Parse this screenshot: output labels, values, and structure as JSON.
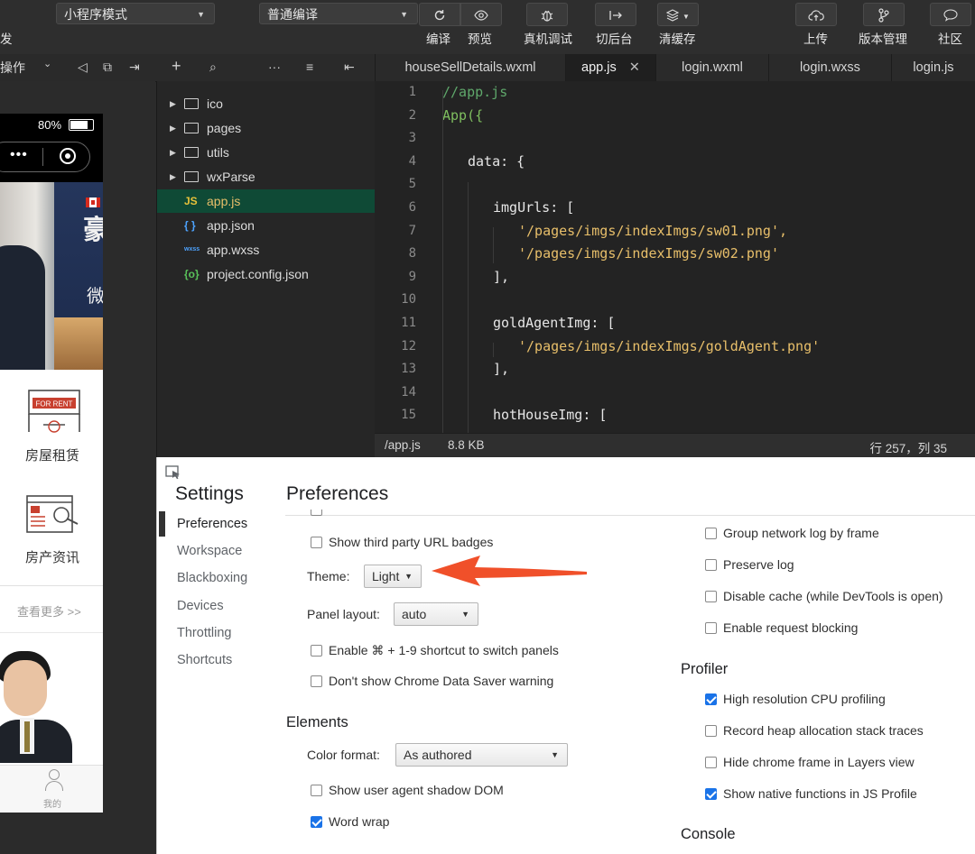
{
  "toolbar": {
    "left_cut_label": "发",
    "mode_select": "小程序模式",
    "compile_select": "普通编译",
    "buttons": [
      "编译",
      "预览",
      "真机调试",
      "切后台",
      "清缓存",
      "上传",
      "版本管理",
      "社区"
    ]
  },
  "subbar": {
    "ops_label": "操作"
  },
  "tabs": [
    "houseSellDetails.wxml",
    "app.js",
    "login.wxml",
    "login.wxss",
    "login.js"
  ],
  "active_tab": "app.js",
  "simulator": {
    "battery": "80%",
    "rent_label": "房屋租赁",
    "news_label": "房产资讯",
    "more_label": "查看更多 >>",
    "mine_label": "我的",
    "sign_text": "FOR RENT",
    "banner_char1": "豪",
    "banner_char2": "微"
  },
  "file_tree": [
    {
      "name": "ico",
      "type": "folder"
    },
    {
      "name": "pages",
      "type": "folder"
    },
    {
      "name": "utils",
      "type": "folder"
    },
    {
      "name": "wxParse",
      "type": "folder"
    },
    {
      "name": "app.js",
      "type": "js",
      "badge": "JS",
      "selected": true
    },
    {
      "name": "app.json",
      "type": "json",
      "badge": "{ }"
    },
    {
      "name": "app.wxss",
      "type": "wxss",
      "badge": "wxss"
    },
    {
      "name": "project.config.json",
      "type": "config",
      "badge": "{o}"
    }
  ],
  "editor": {
    "line_numbers": [
      "1",
      "2",
      "3",
      "4",
      "5",
      "6",
      "7",
      "8",
      "9",
      "10",
      "11",
      "12",
      "13",
      "14",
      "15"
    ],
    "lines": [
      {
        "text": "//app.js",
        "kind": "comment",
        "indent": 0
      },
      {
        "text": "App({",
        "kind": "ident",
        "indent": 0
      },
      {
        "text": "",
        "kind": "plain",
        "indent": 0
      },
      {
        "text": "data: {",
        "kind": "plain",
        "indent": 1
      },
      {
        "text": "",
        "kind": "plain",
        "indent": 0
      },
      {
        "text": "imgUrls: [",
        "kind": "plain",
        "indent": 2
      },
      {
        "text": "'/pages/imgs/indexImgs/sw01.png',",
        "kind": "string",
        "indent": 3
      },
      {
        "text": "'/pages/imgs/indexImgs/sw02.png'",
        "kind": "string",
        "indent": 3
      },
      {
        "text": "],",
        "kind": "plain",
        "indent": 2
      },
      {
        "text": "",
        "kind": "plain",
        "indent": 0
      },
      {
        "text": "goldAgentImg: [",
        "kind": "plain",
        "indent": 2
      },
      {
        "text": "'/pages/imgs/indexImgs/goldAgent.png'",
        "kind": "string",
        "indent": 3
      },
      {
        "text": "],",
        "kind": "plain",
        "indent": 2
      },
      {
        "text": "",
        "kind": "plain",
        "indent": 0
      },
      {
        "text": "hotHouseImg: [",
        "kind": "plain",
        "indent": 2
      }
    ]
  },
  "status_bar": {
    "path": "/app.js",
    "size": "8.8 KB",
    "position": "行 257，列 35"
  },
  "devtools": {
    "settings_title": "Settings",
    "nav": [
      "Preferences",
      "Workspace",
      "Blackboxing",
      "Devices",
      "Throttling",
      "Shortcuts"
    ],
    "pane_title": "Preferences",
    "left": {
      "third_party": {
        "label": "Show third party URL badges",
        "checked": false
      },
      "theme": {
        "label": "Theme:",
        "value": "Light"
      },
      "panel_layout": {
        "label": "Panel layout:",
        "value": "auto"
      },
      "shortcut": {
        "label": "Enable ⌘ + 1-9 shortcut to switch panels",
        "checked": false
      },
      "data_saver": {
        "label": "Don't show Chrome Data Saver warning",
        "checked": false
      },
      "elements_heading": "Elements",
      "color_format": {
        "label": "Color format:",
        "value": "As authored"
      },
      "shadow_dom": {
        "label": "Show user agent shadow DOM",
        "checked": false
      },
      "word_wrap": {
        "label": "Word wrap",
        "checked": true
      }
    },
    "right": {
      "network_options": [
        {
          "label": "Group network log by frame",
          "checked": false
        },
        {
          "label": "Preserve log",
          "checked": false
        },
        {
          "label": "Disable cache (while DevTools is open)",
          "checked": false
        },
        {
          "label": "Enable request blocking",
          "checked": false
        }
      ],
      "profiler_heading": "Profiler",
      "profiler_options": [
        {
          "label": "High resolution CPU profiling",
          "checked": true
        },
        {
          "label": "Record heap allocation stack traces",
          "checked": false
        },
        {
          "label": "Hide chrome frame in Layers view",
          "checked": false
        },
        {
          "label": "Show native functions in JS Profile",
          "checked": true
        }
      ],
      "console_heading": "Console"
    }
  },
  "colors": {
    "arrow": "#f0502a",
    "accent": "#1a73e8",
    "tree_selected": "#0f4a36",
    "code_comment": "#5fa86b",
    "code_string": "#e8bf6a",
    "code_ident": "#7fbf5f"
  }
}
